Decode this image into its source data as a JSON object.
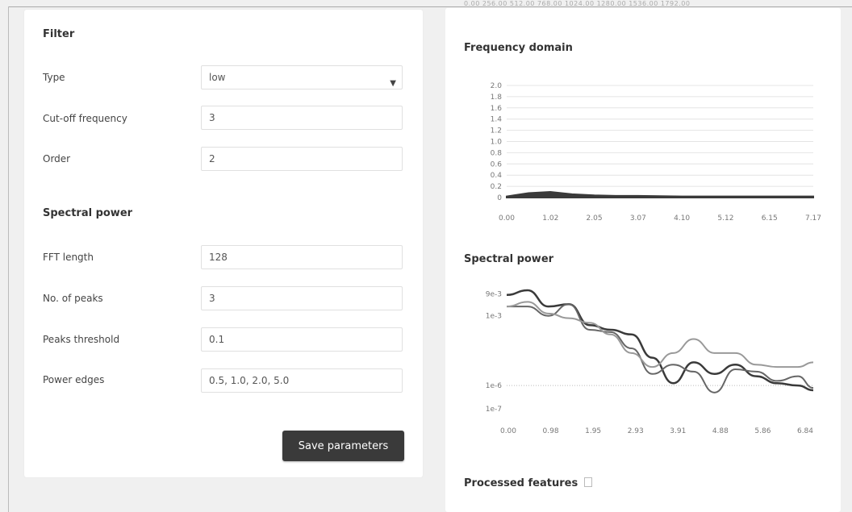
{
  "filter": {
    "title": "Filter",
    "type_label": "Type",
    "type_value": "low",
    "cutoff_label": "Cut-off frequency",
    "cutoff_value": "3",
    "order_label": "Order",
    "order_value": "2"
  },
  "spectral": {
    "title": "Spectral power",
    "fft_label": "FFT length",
    "fft_value": "128",
    "peaks_label": "No. of peaks",
    "peaks_value": "3",
    "threshold_label": "Peaks threshold",
    "threshold_value": "0.1",
    "edges_label": "Power edges",
    "edges_value": "0.5, 1.0, 2.0, 5.0"
  },
  "save_label": "Save parameters",
  "top_ticks": "0.00    256.00    512.00    768.00    1024.00  1280.00  1536.00  1792.00",
  "freq_domain": {
    "title": "Frequency domain",
    "yticks": [
      "2.0",
      "1.8",
      "1.6",
      "1.4",
      "1.2",
      "1.0",
      "0.8",
      "0.6",
      "0.4",
      "0.2",
      "0"
    ],
    "xticks": [
      "0.00",
      "1.02",
      "2.05",
      "3.07",
      "4.10",
      "5.12",
      "6.15",
      "7.17"
    ]
  },
  "spectral_chart": {
    "title": "Spectral power",
    "yticks": [
      "9e-3",
      "1e-3",
      "1e-6",
      "1e-7"
    ],
    "xticks": [
      "0.00",
      "0.98",
      "1.95",
      "2.93",
      "3.91",
      "4.88",
      "5.86",
      "6.84"
    ]
  },
  "processed_title": "Processed features",
  "chart_data": [
    {
      "type": "area",
      "title": "Frequency domain",
      "ylim": [
        0,
        2.0
      ],
      "x": [
        0.0,
        0.51,
        1.02,
        1.53,
        2.05,
        2.56,
        3.07,
        4.1,
        5.12,
        6.15,
        7.17
      ],
      "values": [
        0.02,
        0.08,
        0.1,
        0.06,
        0.04,
        0.03,
        0.03,
        0.02,
        0.02,
        0.02,
        0.02
      ],
      "grid": true
    },
    {
      "type": "line",
      "title": "Spectral power",
      "x": [
        0.0,
        0.49,
        0.98,
        1.46,
        1.95,
        2.44,
        2.93,
        3.42,
        3.91,
        4.39,
        4.88,
        5.37,
        5.86,
        6.35,
        6.84,
        7.2
      ],
      "series": [
        {
          "color": "#3a3a3a",
          "values": [
            -2.1,
            -1.9,
            -2.6,
            -2.5,
            -3.4,
            -3.6,
            -3.8,
            -4.8,
            -5.9,
            -5.0,
            -5.5,
            -5.1,
            -5.6,
            -5.9,
            -6.0,
            -6.2
          ]
        },
        {
          "color": "#666666",
          "values": [
            -2.6,
            -2.6,
            -3.0,
            -2.5,
            -3.6,
            -3.7,
            -4.4,
            -5.5,
            -5.1,
            -5.4,
            -6.3,
            -5.3,
            -5.4,
            -5.8,
            -5.6,
            -6.1
          ]
        },
        {
          "color": "#999999",
          "values": [
            -2.6,
            -2.4,
            -2.9,
            -3.1,
            -3.3,
            -3.8,
            -4.6,
            -5.2,
            -4.6,
            -4.0,
            -4.6,
            -4.6,
            -5.1,
            -5.2,
            -5.2,
            -5.0
          ]
        }
      ]
    }
  ]
}
